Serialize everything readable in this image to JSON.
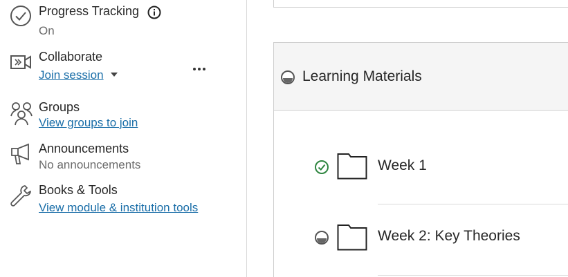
{
  "sidebar": {
    "progress": {
      "title": "Progress Tracking",
      "status": "On"
    },
    "collaborate": {
      "title": "Collaborate",
      "link": "Join session"
    },
    "groups": {
      "title": "Groups",
      "link": "View groups to join"
    },
    "announcements": {
      "title": "Announcements",
      "status": "No announcements"
    },
    "books": {
      "title": "Books & Tools",
      "link": "View module & institution tools"
    }
  },
  "content": {
    "section_title": "Learning Materials",
    "items": [
      {
        "title": "Week 1",
        "status": "completed"
      },
      {
        "title": "Week 2: Key Theories",
        "status": "in-progress"
      }
    ]
  },
  "colors": {
    "link": "#1a6ea8",
    "success": "#2e8540",
    "panel": "#f5f5f5"
  }
}
